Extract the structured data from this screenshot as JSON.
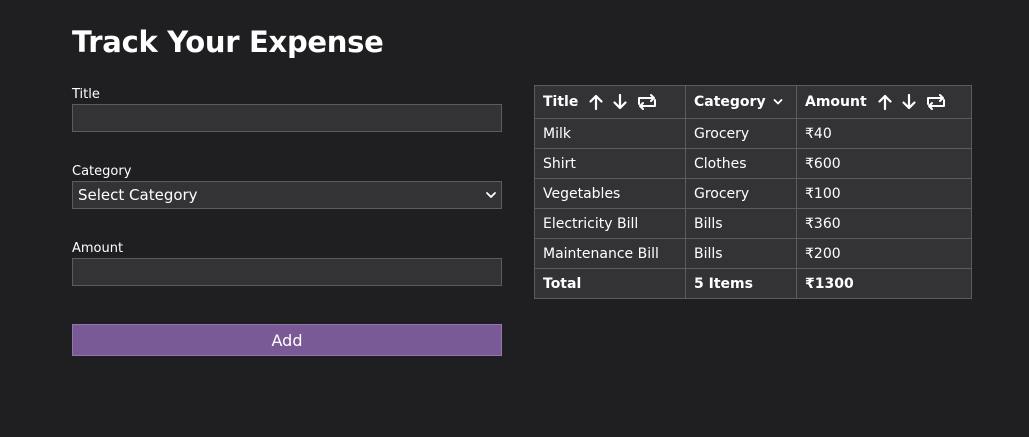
{
  "page": {
    "title": "Track Your Expense"
  },
  "form": {
    "title_label": "Title",
    "title_value": "",
    "category_label": "Category",
    "category_selected": "Select Category",
    "amount_label": "Amount",
    "amount_value": "",
    "add_label": "Add"
  },
  "table": {
    "headers": {
      "title": "Title",
      "category": "Category",
      "amount": "Amount"
    },
    "rows": [
      {
        "title": "Milk",
        "category": "Grocery",
        "amount": "₹40"
      },
      {
        "title": "Shirt",
        "category": "Clothes",
        "amount": "₹600"
      },
      {
        "title": "Vegetables",
        "category": "Grocery",
        "amount": "₹100"
      },
      {
        "title": "Electricity Bill",
        "category": "Bills",
        "amount": "₹360"
      },
      {
        "title": "Maintenance Bill",
        "category": "Bills",
        "amount": "₹200"
      }
    ],
    "total": {
      "label": "Total",
      "items": "5 Items",
      "amount": "₹1300"
    }
  },
  "icons": {
    "sort_ascending": "arrow-up-icon",
    "sort_descending": "arrow-down-icon",
    "reset_sort": "repeat-icon",
    "category_filter": "chevron-down-icon"
  },
  "colors": {
    "background": "#1f1e20",
    "field_background": "#333235",
    "border": "#5c5b5f",
    "accent": "#795a96",
    "text": "#ffffff"
  }
}
